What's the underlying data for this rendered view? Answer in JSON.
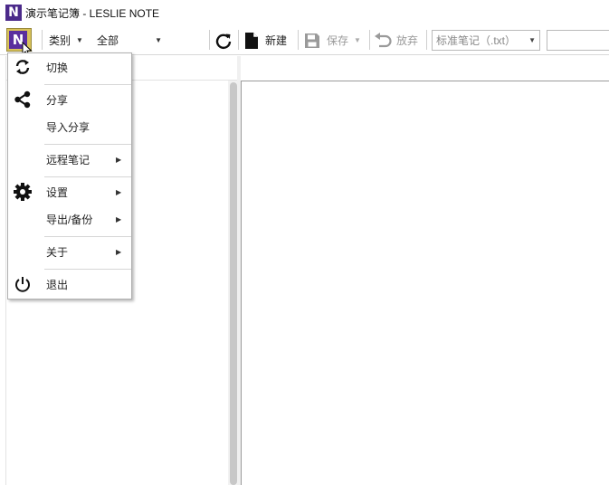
{
  "window": {
    "title": "演示笔记簿 - LESLIE NOTE"
  },
  "toolbar": {
    "category_label": "类别",
    "all_label": "全部",
    "new_label": "新建",
    "save_label": "保存",
    "discard_label": "放弃",
    "note_type_value": "标准笔记（.txt）",
    "search_value": ""
  },
  "menu": {
    "items": [
      {
        "label": "切换",
        "icon": "sync-icon"
      },
      {
        "label": "分享",
        "icon": "share-icon"
      },
      {
        "label": "导入分享",
        "icon": ""
      },
      {
        "label": "远程笔记",
        "icon": "",
        "submenu": true
      },
      {
        "label": "设置",
        "icon": "gear-icon",
        "submenu": true
      },
      {
        "label": "导出/备份",
        "icon": "",
        "submenu": true
      },
      {
        "label": "关于",
        "icon": "",
        "submenu": true
      },
      {
        "label": "退出",
        "icon": "power-icon"
      }
    ]
  },
  "colors": {
    "brand_purple": "#5a2f9e",
    "menu_button_highlight": "#d8c25a",
    "disabled_text": "#9a9a9a"
  }
}
